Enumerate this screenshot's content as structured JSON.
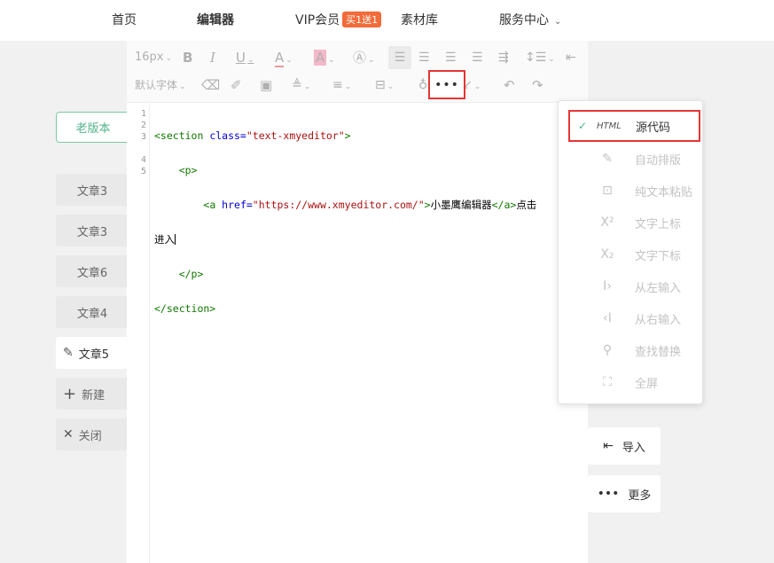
{
  "nav": {
    "home": "首页",
    "editor": "编辑器",
    "vip": "VIP会员",
    "vip_badge": "买1送1",
    "materials": "素材库",
    "service": "服务中心"
  },
  "sidebar": {
    "old_version": "老版本",
    "items": [
      {
        "label": "文章3"
      },
      {
        "label": "文章3"
      },
      {
        "label": "文章6"
      },
      {
        "label": "文章4"
      },
      {
        "label": "文章5"
      }
    ],
    "new": "新建",
    "close": "关闭"
  },
  "toolbar": {
    "font_size": "16px",
    "default_font": "默认字体"
  },
  "code": {
    "line_numbers": [
      "1",
      "2",
      "3",
      "4",
      "5"
    ],
    "l1_open": "<section ",
    "l1_attr": "class=",
    "l1_val": "\"text-xmyeditor\"",
    "l1_close": ">",
    "l2": "<p>",
    "l3_open": "<a ",
    "l3_attr": "href=",
    "l3_val": "\"https://www.xmyeditor.com/\"",
    "l3_gt": ">",
    "l3_text": "小墨鹰编辑器",
    "l3_end": "</a>",
    "l3_text2": "点击",
    "l3_wrap": "进入",
    "l4": "</p>",
    "l5": "</section>"
  },
  "right_buttons": {
    "import": "导入",
    "more": "更多"
  },
  "menu": {
    "items": [
      {
        "label": "源代码",
        "icon": "html-icon"
      },
      {
        "label": "自动排版",
        "icon": "brush-icon"
      },
      {
        "label": "纯文本粘贴",
        "icon": "paste-text-icon"
      },
      {
        "label": "文字上标",
        "icon": "superscript-icon"
      },
      {
        "label": "文字下标",
        "icon": "subscript-icon"
      },
      {
        "label": "从左输入",
        "icon": "ltr-icon"
      },
      {
        "label": "从右输入",
        "icon": "rtl-icon"
      },
      {
        "label": "查找替换",
        "icon": "search-icon"
      },
      {
        "label": "全屏",
        "icon": "fullscreen-icon"
      }
    ]
  },
  "colors": {
    "accent_green": "#4fb38a",
    "highlight_red": "#e53535",
    "badge_orange": "#f26b3a"
  }
}
